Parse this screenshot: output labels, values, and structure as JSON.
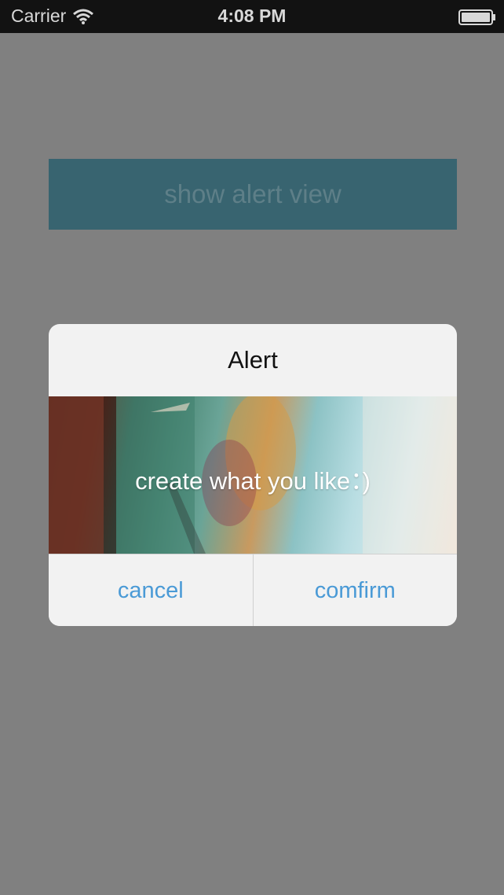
{
  "status_bar": {
    "carrier": "Carrier",
    "time": "4:08 PM",
    "wifi_icon": "wifi-icon",
    "battery_icon": "battery-icon"
  },
  "main": {
    "show_alert_button_label": "show alert view",
    "button_color": "#386470"
  },
  "alert": {
    "title": "Alert",
    "message": "create what you like：)",
    "cancel_label": "cancel",
    "confirm_label": "comfirm",
    "button_text_color": "#4a9ad6"
  }
}
